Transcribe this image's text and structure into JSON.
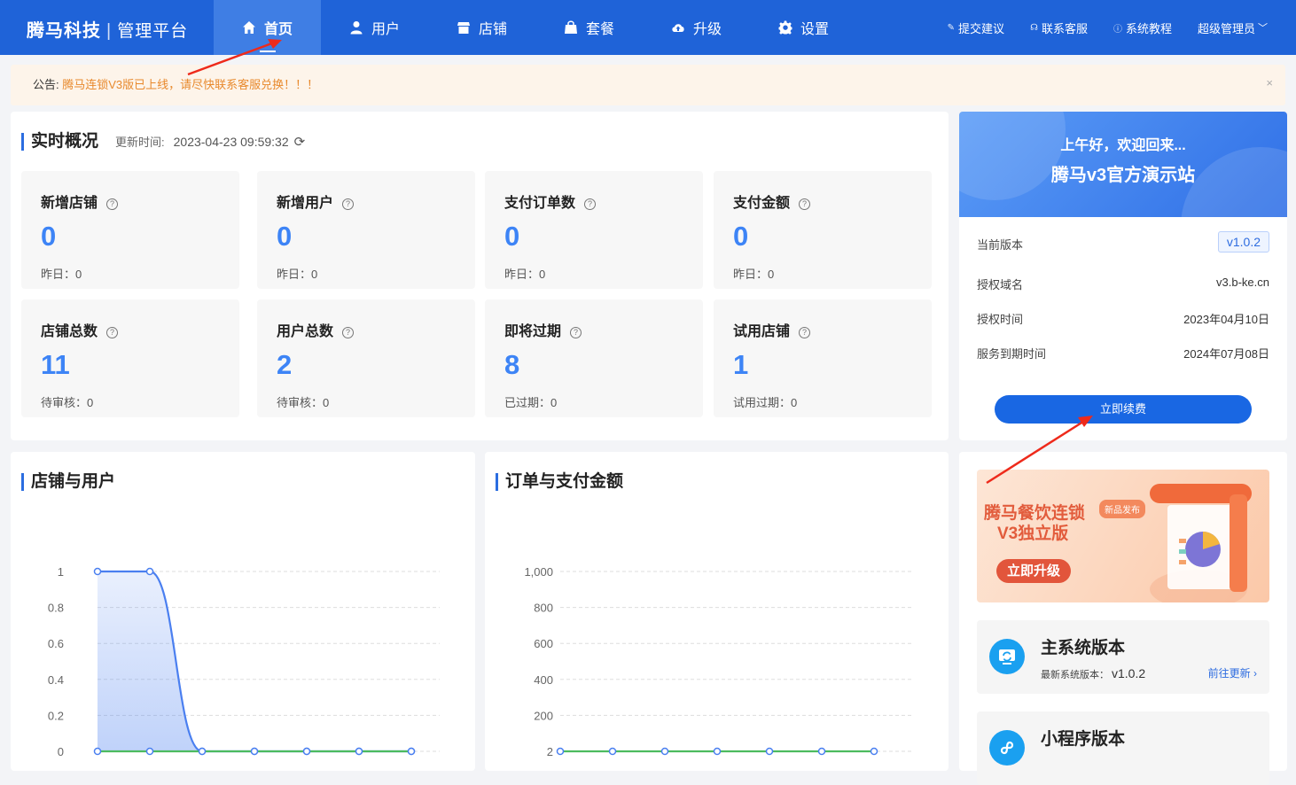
{
  "header": {
    "brand": "腾马科技",
    "brand_sub": "管理平台",
    "nav": [
      {
        "label": "首页",
        "icon": "home-icon",
        "active": true
      },
      {
        "label": "用户",
        "icon": "user-icon"
      },
      {
        "label": "店铺",
        "icon": "shop-icon"
      },
      {
        "label": "套餐",
        "icon": "bag-icon"
      },
      {
        "label": "升级",
        "icon": "cloud-upload-icon"
      },
      {
        "label": "设置",
        "icon": "gear-icon"
      }
    ],
    "links": {
      "suggest": "提交建议",
      "service": "联系客服",
      "tutorial": "系统教程",
      "admin": "超级管理员"
    }
  },
  "notice": {
    "prefix": "公告:",
    "message": "腾马连锁V3版已上线，请尽快联系客服兑换！！！",
    "close": "×"
  },
  "overview": {
    "title": "实时概况",
    "update_label": "更新时间:",
    "update_time": "2023-04-23 09:59:32",
    "refresh": "⟳",
    "stats": [
      {
        "title": "新增店铺",
        "value": "0",
        "sub": "昨日：0"
      },
      {
        "title": "新增用户",
        "value": "0",
        "sub": "昨日：0"
      },
      {
        "title": "支付订单数",
        "value": "0",
        "sub": "昨日：0"
      },
      {
        "title": "支付金额",
        "value": "0",
        "sub": "昨日：0"
      },
      {
        "title": "店铺总数",
        "value": "11",
        "sub": "待审核：0"
      },
      {
        "title": "用户总数",
        "value": "2",
        "sub": "待审核：0"
      },
      {
        "title": "即将过期",
        "value": "8",
        "sub": "已过期：0"
      },
      {
        "title": "试用店铺",
        "value": "1",
        "sub": "试用过期：0"
      }
    ]
  },
  "welcome": {
    "greeting": "上午好，欢迎回来...",
    "site": "腾马v3官方演示站"
  },
  "license": {
    "version_label": "当前版本",
    "version": "v1.0.2",
    "domain_label": "授权域名",
    "domain": "v3.b-ke.cn",
    "auth_label": "授权时间",
    "auth_date": "2023年04月10日",
    "expire_label": "服务到期时间",
    "expire_date": "2024年07月08日",
    "renew": "立即续费"
  },
  "promo": {
    "line1": "腾马餐饮连锁",
    "line2": "V3独立版",
    "tag": "新品发布",
    "button": "立即升级"
  },
  "versions": [
    {
      "title": "主系统版本",
      "desc": "最新系统版本：",
      "num": "v1.0.2",
      "link": "前往更新 ›"
    },
    {
      "title": "小程序版本"
    }
  ],
  "chart_data": [
    {
      "type": "area",
      "title": "店铺与用户",
      "ylim": [
        0,
        1
      ],
      "yticks": [
        "0",
        "0.2",
        "0.4",
        "0.6",
        "0.8",
        "1"
      ],
      "series": [
        {
          "values": [
            1,
            1,
            0,
            0,
            0,
            0,
            0
          ],
          "color": "#4a7ff0"
        },
        {
          "values": [
            0,
            0,
            0,
            0,
            0,
            0,
            0
          ],
          "color": "#4cbb5f"
        }
      ]
    },
    {
      "type": "line",
      "title": "订单与支付金额",
      "ylim": [
        0,
        1000
      ],
      "yticks": [
        "2",
        "200",
        "400",
        "600",
        "800",
        "1,000"
      ],
      "series": [
        {
          "values": [
            0,
            0,
            0,
            0,
            0,
            0,
            0
          ],
          "color": "#4cbb5f"
        }
      ]
    }
  ]
}
